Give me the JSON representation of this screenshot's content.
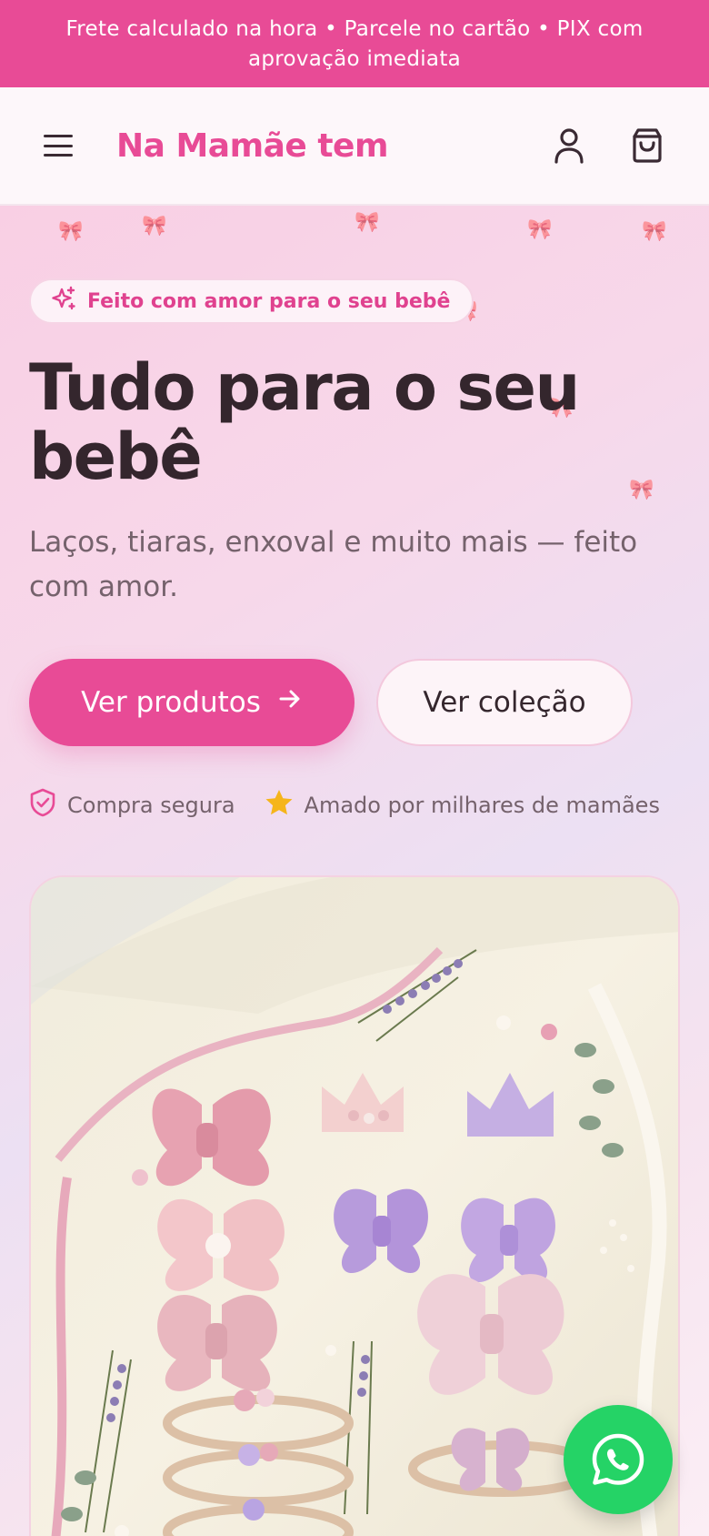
{
  "announcement": "Frete calculado na hora • Parcele no cartão • PIX com aprovação imediata",
  "header": {
    "brand": "Na Mamãe tem"
  },
  "hero": {
    "badge": "Feito com amor para o seu bebê",
    "title": "Tudo para o seu bebê",
    "subtitle": "Laços, tiaras, enxoval e muito mais — feito com amor.",
    "primary_button": "Ver produtos",
    "secondary_button": "Ver coleção",
    "trust": [
      {
        "icon": "shield-check-icon",
        "label": "Compra segura"
      },
      {
        "icon": "star-icon",
        "label": "Amado por milhares de mamães"
      }
    ]
  },
  "colors": {
    "brand_pink": "#e84b96",
    "title_text": "#34262d",
    "star_yellow": "#f5b51b",
    "whatsapp_green": "#25d366"
  },
  "icons": {
    "menu": "menu-icon",
    "account": "user-icon",
    "cart": "shopping-bag-icon",
    "badge": "sparkles-icon",
    "button_arrow": "arrow-right-icon",
    "chat": "whatsapp-icon"
  }
}
